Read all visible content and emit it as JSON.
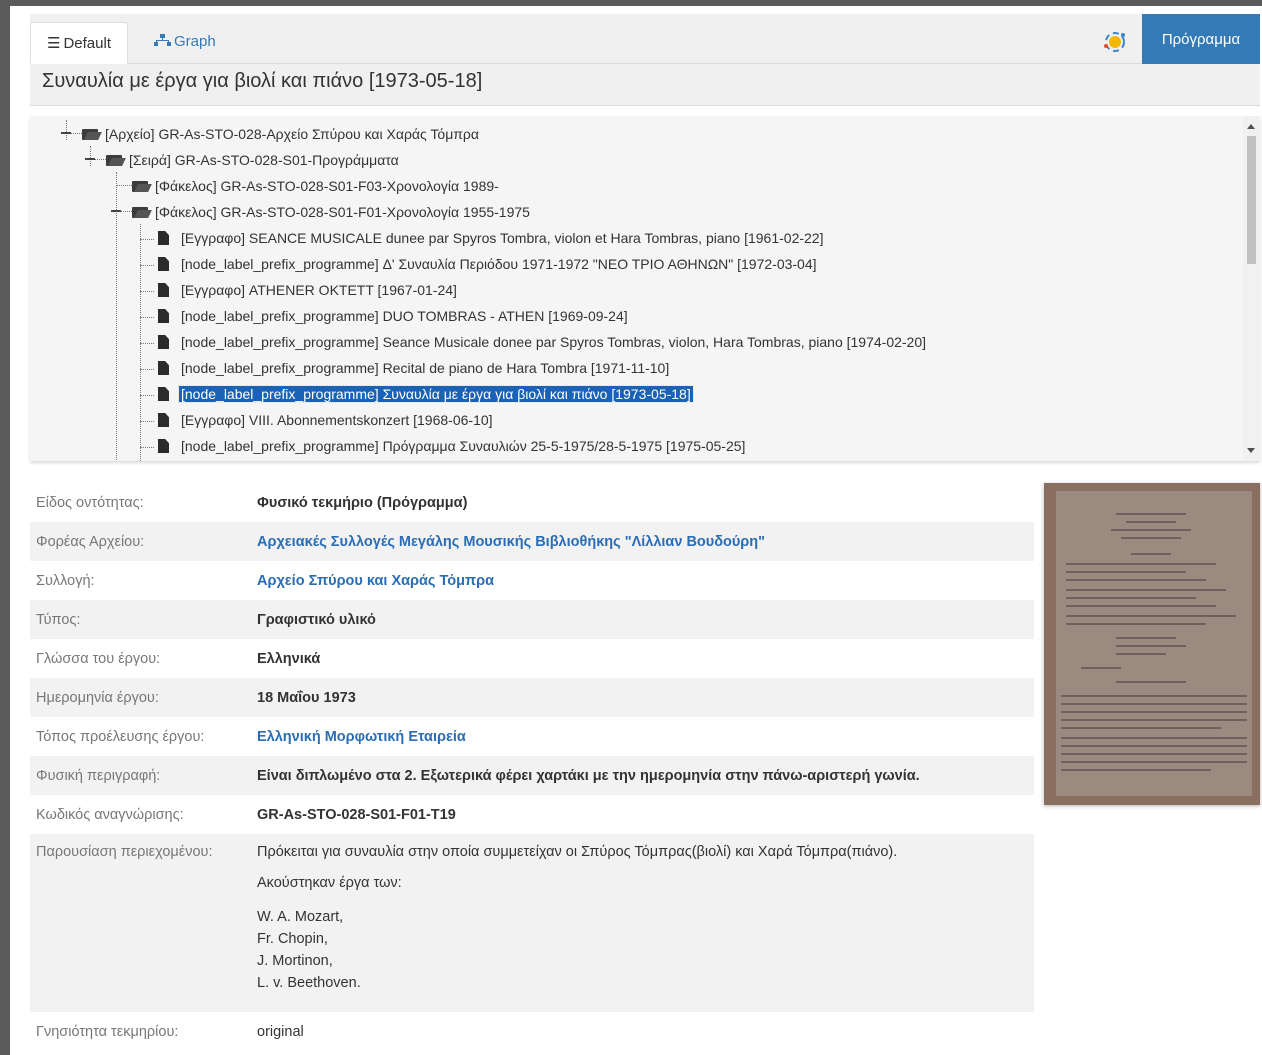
{
  "tabs": [
    {
      "label": "Default",
      "icon": "list-icon"
    },
    {
      "label": "Graph",
      "icon": "sitemap-icon"
    }
  ],
  "program_button": "Πρόγραμμα",
  "page_title": "Συναυλία με έργα για βιολί και πιάνο [1973-05-18]",
  "tree": [
    {
      "label": "[Αρχείο] GR-As-STO-028-Αρχείο Σπύρου και Χαράς Τόμπρα",
      "type": "folder",
      "level": 0
    },
    {
      "label": "[Σειρά] GR-As-STO-028-S01-Προγράμματα",
      "type": "folder",
      "level": 1
    },
    {
      "label": "[Φάκελος] GR-As-STO-028-S01-F03-Χρονολογία 1989-",
      "type": "folder",
      "level": 2
    },
    {
      "label": "[Φάκελος] GR-As-STO-028-S01-F01-Χρονολογία 1955-1975",
      "type": "folder",
      "level": 2
    },
    {
      "label": "[Εγγραφο] SEANCE MUSICALE dunee par Spyros Tombra, violon et Hara Tombras, piano [1961-02-22]",
      "type": "file",
      "level": 3
    },
    {
      "label": "[node_label_prefix_programme] Δ' Συναυλία Περιόδου 1971-1972 \"ΝΕΟ ΤΡΙΟ ΑΘΗΝΩΝ\" [1972-03-04]",
      "type": "file",
      "level": 3
    },
    {
      "label": "[Εγγραφο] ATHENER OKTETT [1967-01-24]",
      "type": "file",
      "level": 3
    },
    {
      "label": "[node_label_prefix_programme] DUO TOMBRAS - ATHEN [1969-09-24]",
      "type": "file",
      "level": 3
    },
    {
      "label": "[node_label_prefix_programme] Seance Musicale donee par Spyros Tombras, violon, Hara Tombras, piano [1974-02-20]",
      "type": "file",
      "level": 3
    },
    {
      "label": "[node_label_prefix_programme] Recital de piano de Hara Tombra [1971-11-10]",
      "type": "file",
      "level": 3
    },
    {
      "label": "[node_label_prefix_programme] Συναυλία με έργα για βιολί και πιάνο [1973-05-18]",
      "type": "file",
      "level": 3,
      "selected": true
    },
    {
      "label": "[Εγγραφο] VIII. Abonnementskonzert [1968-06-10]",
      "type": "file",
      "level": 3
    },
    {
      "label": "[node_label_prefix_programme] Πρόγραμμα Συναυλιών 25-5-1975/28-5-1975 [1975-05-25]",
      "type": "file",
      "level": 3
    }
  ],
  "details": [
    {
      "label": "Είδος οντότητας:",
      "value": "Φυσικό τεκμήριο (Πρόγραμμα)"
    },
    {
      "label": "Φορέας Αρχείου:",
      "value": "Αρχειακές Συλλογές Μεγάλης Μουσικής Βιβλιοθήκης \"Λίλλιαν Βουδούρη\""
    },
    {
      "label": "Συλλογή:",
      "value": "Αρχείο Σπύρου και Χαράς Τόμπρα"
    },
    {
      "label": "Τύπος:",
      "value": "Γραφιστικό υλικό"
    },
    {
      "label": "Γλώσσα του έργου:",
      "value": "Ελληνικά"
    },
    {
      "label": "Ημερομηνία έργου:",
      "value": "18 Μαΐου 1973"
    },
    {
      "label": "Τόπος προέλευσης έργου:",
      "value": "Ελληνική Μορφωτική Εταιρεία"
    },
    {
      "label": "Φυσική περιγραφή:",
      "value": "Είναι διπλωμένο στα 2. Εξωτερικά φέρει χαρτάκι με την ημερομηνία στην πάνω-αριστερή γωνία."
    },
    {
      "label": "Κωδικός αναγνώρισης:",
      "value": "GR-As-STO-028-S01-F01-T19"
    }
  ],
  "content": {
    "label": "Παρουσίαση περιεχομένου:",
    "para1": "Πρόκειται για συναυλία στην οποία συμμετείχαν οι Σπύρος Τόμπρας(βιολί) και Χαρά Τόμπρα(πιάνο).",
    "para2": "Ακούστηκαν έργα των:",
    "composers": [
      "W. A. Mozart,",
      "Fr. Chopin,",
      "J. Mortinon,",
      "L. v. Beethoven."
    ]
  },
  "authenticity": {
    "label": "Γνησιότητα τεκμηρίου:",
    "value": "original"
  },
  "colors": {
    "accent": "#337ab7",
    "selected": "#1a62b5",
    "link": "#2a6db5"
  }
}
